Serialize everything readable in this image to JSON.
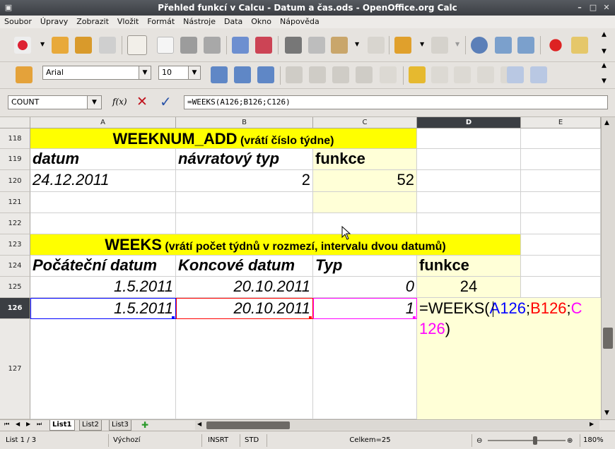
{
  "window": {
    "title": "Přehled funkcí v Calcu - Datum a čas.ods - OpenOffice.org Calc"
  },
  "menu": [
    "Soubor",
    "Úpravy",
    "Zobrazit",
    "Vložit",
    "Formát",
    "Nástroje",
    "Data",
    "Okno",
    "Nápověda"
  ],
  "format": {
    "font": "Arial",
    "size": "10"
  },
  "formula": {
    "name_box": "COUNT",
    "fx_label": "f(x)",
    "content": "=WEEKS(A126;B126;C126)"
  },
  "columns": [
    "A",
    "B",
    "C",
    "D",
    "E"
  ],
  "rows": [
    "118",
    "119",
    "120",
    "121",
    "122",
    "123",
    "124",
    "125",
    "126",
    "127"
  ],
  "cells": {
    "r118_title": "WEEKNUM_ADD",
    "r118_sub": " (vrátí číslo týdne)",
    "r119_a": "datum",
    "r119_b": "návratový typ",
    "r119_c": "funkce",
    "r120_a": "24.12.2011",
    "r120_b": "2",
    "r120_c": "52",
    "r123_title": "WEEKS",
    "r123_sub": " (vrátí počet týdnů v rozmezí, intervalu dvou datumů)",
    "r124_a": "Počáteční datum",
    "r124_b": "Koncové datum",
    "r124_c": "Typ",
    "r124_d": "funkce",
    "r125_a": "1.5.2011",
    "r125_b": "20.10.2011",
    "r125_c": "0",
    "r125_d": "24",
    "r126_a": "1.5.2011",
    "r126_b": "20.10.2011",
    "r126_c": "1",
    "edit_prefix": "=WEEKS(",
    "edit_ref1": "A126",
    "edit_semi1": ";",
    "edit_ref2": "B126",
    "edit_semi2": ";",
    "edit_ref3a": "C",
    "edit_ref3b": "126",
    "edit_close": ")"
  },
  "colors": {
    "ref1": "#0000ff",
    "ref2": "#ff0000",
    "ref3": "#ff00ff",
    "header_fill": "#ffff00",
    "result_fill": "#ffffd7"
  },
  "sheets": [
    "List1",
    "List2",
    "List3"
  ],
  "status": {
    "sheet": "List 1 / 3",
    "style": "Výchozí",
    "mode": "INSRT",
    "sel": "STD",
    "sum": "Celkem=25",
    "zoom": "180%"
  }
}
